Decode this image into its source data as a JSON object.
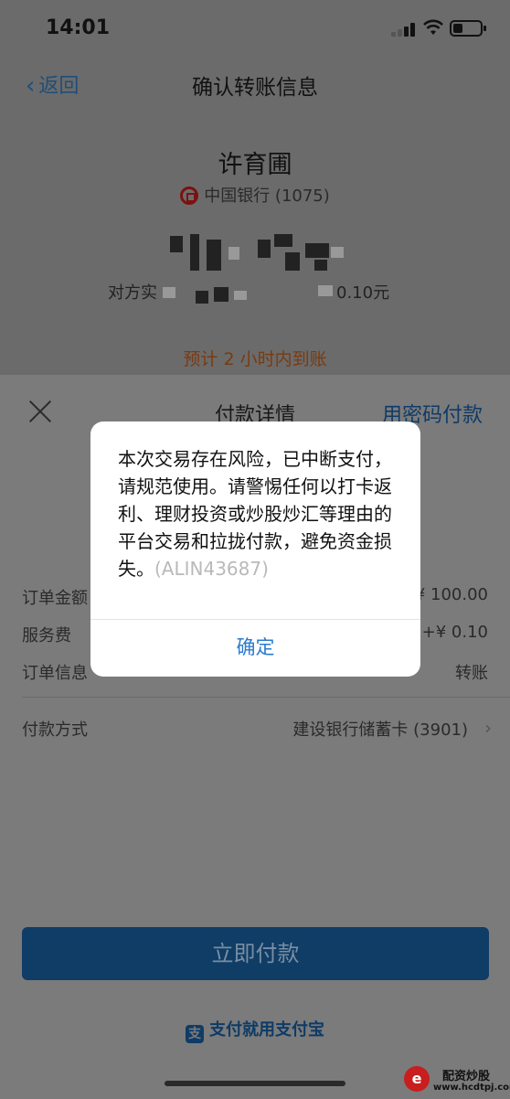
{
  "status_bar": {
    "time": "14:01"
  },
  "nav": {
    "back_label": "返回",
    "title": "确认转账信息"
  },
  "transfer": {
    "payee_name": "许育圃",
    "bank": "中国银行 (1075)",
    "counterparty_prefix": "对方实",
    "fee_suffix": "0.10元",
    "eta": "预计 2 小时内到账"
  },
  "sheet": {
    "title": "付款详情",
    "password_pay": "用密码付款",
    "rows": [
      {
        "label": "订单金额",
        "value": "¥ 100.00"
      },
      {
        "label": "服务费",
        "value": "+¥ 0.10"
      },
      {
        "label": "订单信息",
        "value": "转账"
      }
    ],
    "payment_method": {
      "label": "付款方式",
      "value": "建设银行储蓄卡 (3901)"
    },
    "pay_button": "立即付款",
    "brand": "支付就用支付宝"
  },
  "dialog": {
    "message": "本次交易存在风险，已中断支付，请规范使用。请警惕任何以打卡返利、理财投资或炒股炒汇等理由的平台交易和拉拢付款，避免资金损失。",
    "code": "(ALIN43687)",
    "ok_label": "确定"
  },
  "watermark": {
    "name": "配资炒股",
    "url": "www.hcdtpj.com"
  },
  "colors": {
    "accent": "#2b7ad0",
    "dim_overlay": "#5e5e5e",
    "pay_button": "#0f3d66"
  }
}
